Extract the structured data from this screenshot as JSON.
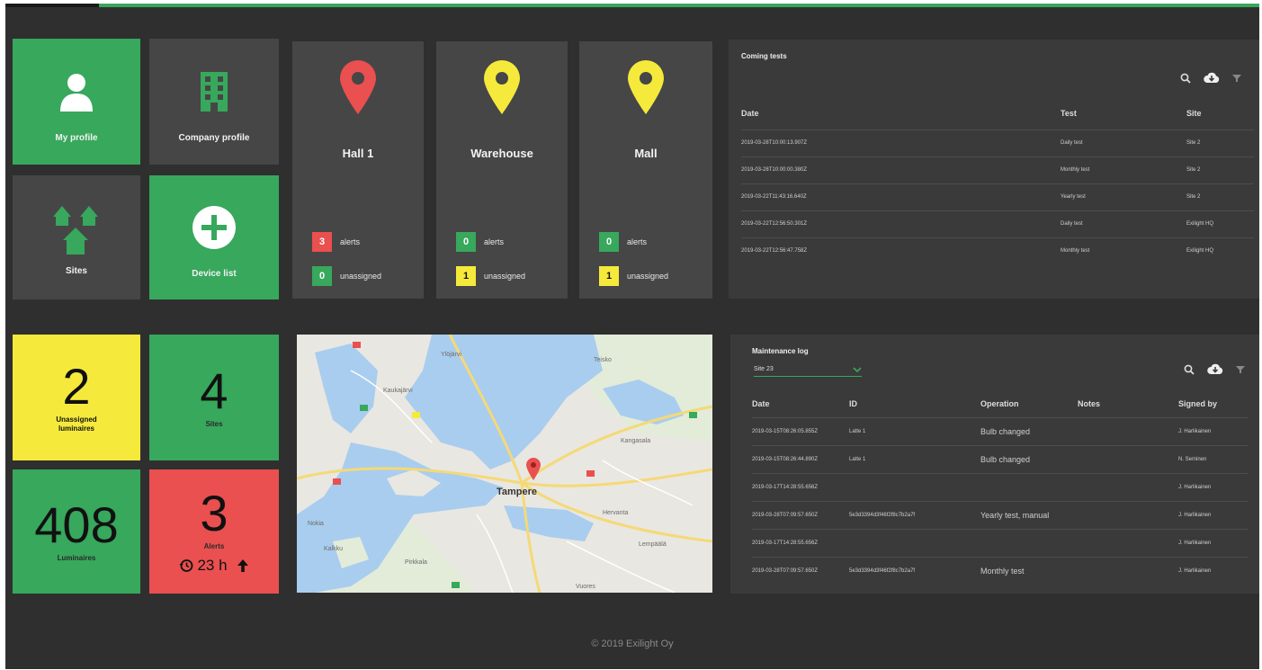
{
  "nav": {
    "my_profile": "My profile",
    "company_profile": "Company profile",
    "sites": "Sites",
    "device_list": "Device list"
  },
  "sites": [
    {
      "name": "Hall 1",
      "pin_color": "#e9504f",
      "alerts": "3",
      "alerts_label": "alerts",
      "unassigned": "0",
      "unassigned_label": "unassigned"
    },
    {
      "name": "Warehouse",
      "pin_color": "#f5ea3b",
      "alerts": "0",
      "alerts_label": "alerts",
      "unassigned": "1",
      "unassigned_label": "unassigned"
    },
    {
      "name": "Mall",
      "pin_color": "#f5ea3b",
      "alerts": "0",
      "alerts_label": "alerts",
      "unassigned": "1",
      "unassigned_label": "unassigned"
    }
  ],
  "stats": {
    "unassigned": {
      "value": "2",
      "caption": "Unassigned luminaires"
    },
    "sites": {
      "value": "4",
      "caption": "Sites"
    },
    "luminaires": {
      "value": "408",
      "caption": "Luminaires"
    },
    "alerts": {
      "value": "3",
      "caption": "Alerts",
      "history": "23 h"
    }
  },
  "coming_tests": {
    "title": "Coming tests",
    "columns": [
      "Date",
      "Test",
      "Site"
    ],
    "rows": [
      [
        "2019-03-28T10:00:13.907Z",
        "Daily test",
        "Site 2"
      ],
      [
        "2019-03-28T10:00:00.380Z",
        "Monthly test",
        "Site 2"
      ],
      [
        "2019-03-22T11:43:16.640Z",
        "Yearly test",
        "Site 2"
      ],
      [
        "2019-03-22T12:56:50.301Z",
        "Daily test",
        "Exilight HQ"
      ],
      [
        "2019-03-22T12:56:47.758Z",
        "Monthly test",
        "Exilight HQ"
      ]
    ]
  },
  "maintenance_log": {
    "title": "Maintenance log",
    "selected_site": "Site 23",
    "columns": [
      "Date",
      "ID",
      "Operation",
      "Notes",
      "Signed by"
    ],
    "rows": [
      [
        "2019-03-15T08:26:05.855Z",
        "Latte 1",
        "Bulb changed",
        "",
        "J. Harlikainen"
      ],
      [
        "2019-03-15T08:26:44.890Z",
        "Latte 1",
        "Bulb changed",
        "",
        "N. Seminen"
      ],
      [
        "2019-03-17T14:28:55.656Z",
        "",
        "",
        "",
        "J. Harlikainen"
      ],
      [
        "2019-03-28T07:09:57.650Z",
        "5e3d3394d3f46f2f8c7b2a7f",
        "Yearly test, manual",
        "",
        "J. Harlikainen"
      ],
      [
        "2019-03-17T14:28:55.656Z",
        "",
        "",
        "",
        "J. Harlikainen"
      ],
      [
        "2019-03-28T07:09:57.650Z",
        "5e3d3394d3f46f2f8c7b2a7f",
        "Monthly test",
        "",
        "J. Harlikainen"
      ]
    ]
  },
  "map": {
    "labels": [
      "Ylöjärvi",
      "Kangasala",
      "Tampere",
      "Nokia",
      "Pirkkala",
      "Lempäälä",
      "Teisko",
      "Hervanta",
      "Kaukajärvi",
      "Kalkku",
      "Vuores"
    ],
    "pin_label": "Tampere"
  },
  "footer": "© 2019 Exilight Oy",
  "colors": {
    "green": "#37a85c",
    "yellow": "#f5ea3b",
    "red": "#e9504f",
    "tile_dark": "#464646",
    "background": "#2f2f2f"
  }
}
